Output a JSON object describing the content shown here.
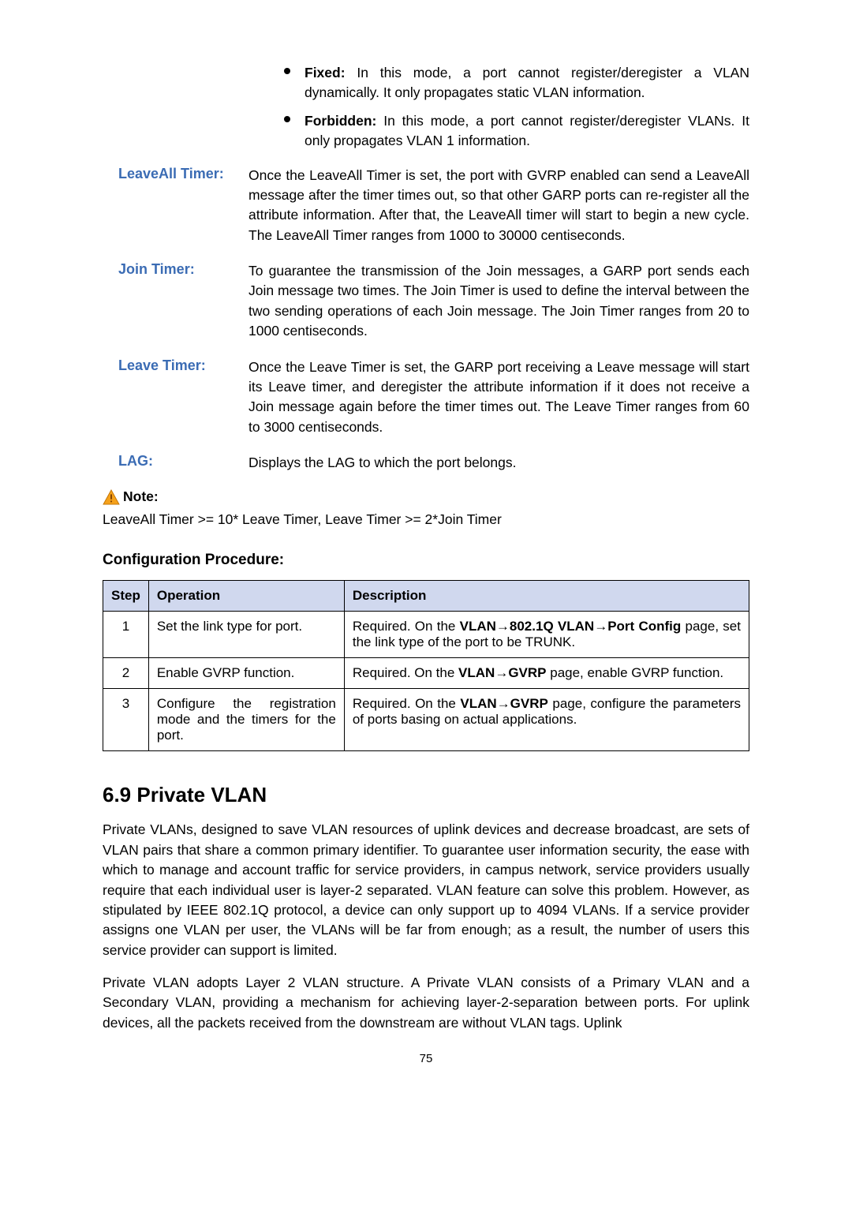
{
  "bullets": {
    "fixed": {
      "label": "Fixed:",
      "text": " In this mode, a port cannot register/deregister a VLAN dynamically. It only propagates static VLAN information."
    },
    "forbidden": {
      "label": "Forbidden:",
      "text": " In this mode, a port cannot register/deregister VLANs. It only propagates VLAN 1 information."
    }
  },
  "defs": {
    "leaveall": {
      "label": "LeaveAll Timer:",
      "body": "Once the LeaveAll Timer is set, the port with GVRP enabled can send a LeaveAll message after the timer times out, so that other GARP ports can re-register all the attribute information. After that, the LeaveAll timer will start to begin a new cycle. The LeaveAll Timer ranges from 1000 to 30000 centiseconds."
    },
    "join": {
      "label": "Join Timer:",
      "body": "To guarantee the transmission of the Join messages, a GARP port sends each Join message two times. The Join Timer is used to define the interval between the two sending operations of each Join message. The Join Timer ranges from 20 to 1000 centiseconds."
    },
    "leave": {
      "label": "Leave Timer:",
      "body": "Once the Leave Timer is set, the GARP port receiving a Leave message will start its Leave timer, and deregister the attribute information if it does not receive a Join message again before the timer times out. The Leave Timer ranges from 60 to 3000 centiseconds."
    },
    "lag": {
      "label": "LAG:",
      "body": "Displays the LAG to which the port belongs."
    }
  },
  "note": {
    "label": "Note:",
    "text": "LeaveAll Timer >= 10* Leave Timer, Leave Timer >= 2*Join Timer"
  },
  "procedure": {
    "heading": "Configuration Procedure:",
    "thead": {
      "step": "Step",
      "op": "Operation",
      "desc": "Description"
    },
    "rows": [
      {
        "step": "1",
        "op": "Set the link type for port.",
        "desc_pre": "Required. On the ",
        "desc_bold": "VLAN→802.1Q VLAN→Port Config",
        "desc_post": " page, set the link type of the port to be TRUNK."
      },
      {
        "step": "2",
        "op": "Enable GVRP function.",
        "desc_pre": "Required. On the ",
        "desc_bold": "VLAN→GVRP",
        "desc_post": " page, enable GVRP function."
      },
      {
        "step": "3",
        "op": "Configure the registration mode and the timers for the port.",
        "desc_pre": "Required. On the ",
        "desc_bold": "VLAN→GVRP",
        "desc_post": " page, configure the parameters of ports basing on actual applications."
      }
    ]
  },
  "section": {
    "title": "6.9  Private VLAN",
    "para1": "Private VLANs, designed to save VLAN resources of uplink devices and decrease broadcast, are sets of VLAN pairs that share a common primary identifier. To guarantee user information security, the ease with which to manage and account traffic for service providers, in campus network, service providers usually require that each individual user is layer-2 separated. VLAN feature can solve this problem. However, as stipulated by IEEE 802.1Q protocol, a device can only support up to 4094 VLANs. If a service provider assigns one VLAN per user, the VLANs will be far from enough; as a result, the number of users this service provider can support is limited.",
    "para2": "Private VLAN adopts Layer 2 VLAN structure. A Private VLAN consists of a Primary VLAN and a Secondary VLAN, providing a mechanism for achieving layer-2-separation between ports. For uplink devices, all the packets received from the downstream are without VLAN tags. Uplink"
  },
  "page_number": "75"
}
